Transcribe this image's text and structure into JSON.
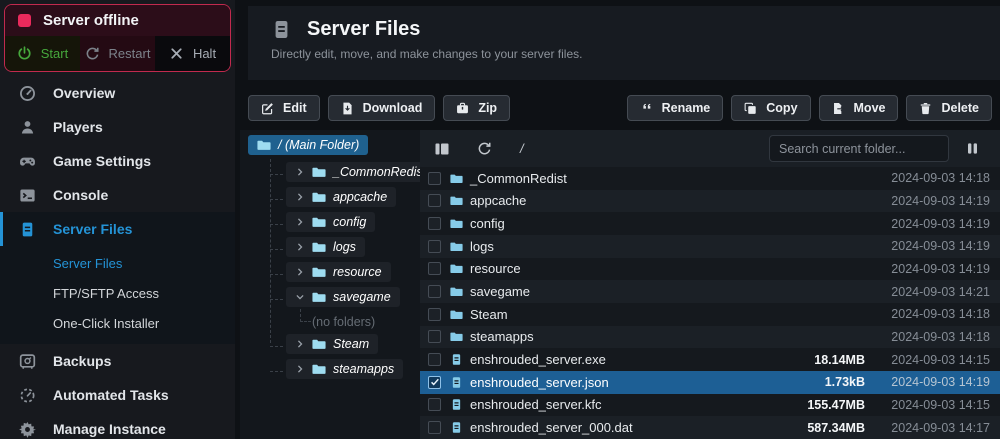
{
  "colors": {
    "accent": "#2493d6",
    "danger": "#ea2a5c",
    "success": "#46a73c",
    "selection": "#1d5f95"
  },
  "status_panel": {
    "title": "Server offline",
    "actions": [
      {
        "id": "start",
        "label": "Start",
        "icon": "power"
      },
      {
        "id": "restart",
        "label": "Restart",
        "icon": "refresh"
      },
      {
        "id": "halt",
        "label": "Halt",
        "icon": "xmark"
      }
    ]
  },
  "sidebar": {
    "items": [
      {
        "id": "overview",
        "label": "Overview",
        "icon": "gauge"
      },
      {
        "id": "players",
        "label": "Players",
        "icon": "person"
      },
      {
        "id": "game-settings",
        "label": "Game Settings",
        "icon": "gamepad"
      },
      {
        "id": "console",
        "label": "Console",
        "icon": "terminal"
      },
      {
        "id": "server-files",
        "label": "Server Files",
        "icon": "filedoc",
        "active": true,
        "children": [
          {
            "id": "server-files-sub",
            "label": "Server Files",
            "active": true
          },
          {
            "id": "ftp-sftp-access",
            "label": "FTP/SFTP Access"
          },
          {
            "id": "one-click-installer",
            "label": "One-Click Installer"
          }
        ]
      },
      {
        "id": "backups",
        "label": "Backups",
        "icon": "safe"
      },
      {
        "id": "automated-tasks",
        "label": "Automated Tasks",
        "icon": "tasks"
      },
      {
        "id": "manage-instance",
        "label": "Manage Instance",
        "icon": "gear"
      }
    ]
  },
  "header": {
    "title": "Server Files",
    "subtitle": "Directly edit, move, and make changes to your server files."
  },
  "toolbar": {
    "left": [
      {
        "id": "edit",
        "label": "Edit",
        "icon": "edit"
      },
      {
        "id": "download",
        "label": "Download",
        "icon": "download"
      },
      {
        "id": "zip",
        "label": "Zip",
        "icon": "zip"
      }
    ],
    "right": [
      {
        "id": "rename",
        "label": "Rename",
        "icon": "quote"
      },
      {
        "id": "copy",
        "label": "Copy",
        "icon": "copy"
      },
      {
        "id": "move",
        "label": "Move",
        "icon": "move"
      },
      {
        "id": "delete",
        "label": "Delete",
        "icon": "trash"
      }
    ]
  },
  "tree": {
    "root_label": "/  (Main Folder)",
    "nodes": [
      {
        "label": "_CommonRedist"
      },
      {
        "label": "appcache"
      },
      {
        "label": "config"
      },
      {
        "label": "logs"
      },
      {
        "label": "resource"
      },
      {
        "label": "savegame",
        "expanded": true,
        "empty_label": "(no folders)"
      },
      {
        "label": "Steam"
      },
      {
        "label": "steamapps"
      }
    ]
  },
  "file_browser": {
    "path": "/",
    "search_placeholder": "Search current folder...",
    "rows": [
      {
        "name": "_CommonRedist",
        "type": "folder",
        "size": "",
        "modified": "2024-09-03 14:18"
      },
      {
        "name": "appcache",
        "type": "folder",
        "size": "",
        "modified": "2024-09-03 14:19"
      },
      {
        "name": "config",
        "type": "folder",
        "size": "",
        "modified": "2024-09-03 14:19"
      },
      {
        "name": "logs",
        "type": "folder",
        "size": "",
        "modified": "2024-09-03 14:19"
      },
      {
        "name": "resource",
        "type": "folder",
        "size": "",
        "modified": "2024-09-03 14:19"
      },
      {
        "name": "savegame",
        "type": "folder",
        "size": "",
        "modified": "2024-09-03 14:21"
      },
      {
        "name": "Steam",
        "type": "folder",
        "size": "",
        "modified": "2024-09-03 14:18"
      },
      {
        "name": "steamapps",
        "type": "folder",
        "size": "",
        "modified": "2024-09-03 14:18"
      },
      {
        "name": "enshrouded_server.exe",
        "type": "file",
        "size": "18.14MB",
        "modified": "2024-09-03 14:15"
      },
      {
        "name": "enshrouded_server.json",
        "type": "file",
        "size": "1.73kB",
        "modified": "2024-09-03 14:19",
        "selected": true,
        "checked": true
      },
      {
        "name": "enshrouded_server.kfc",
        "type": "file",
        "size": "155.47MB",
        "modified": "2024-09-03 14:15"
      },
      {
        "name": "enshrouded_server_000.dat",
        "type": "file",
        "size": "587.34MB",
        "modified": "2024-09-03 14:17"
      }
    ]
  }
}
